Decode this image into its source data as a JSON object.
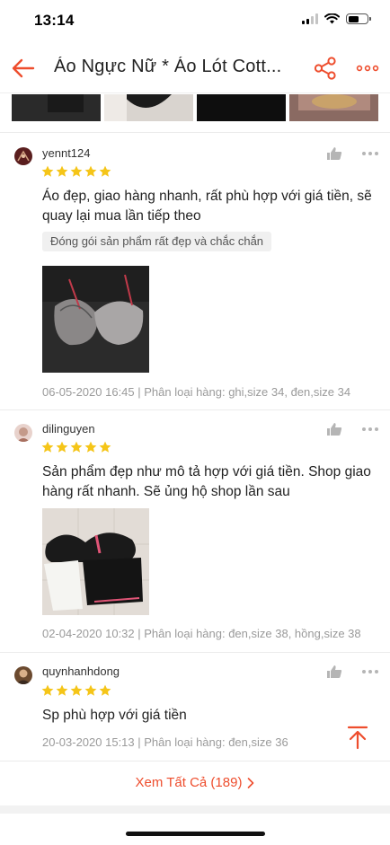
{
  "status_bar": {
    "time": "13:14",
    "battery_level": 0.55
  },
  "nav": {
    "title": "Áo Ngực Nữ * Áo Lót Cott..."
  },
  "icons": {
    "back": "arrow-left-icon",
    "share": "share-icon",
    "more": "more-dots-icon",
    "like": "thumbs-up-icon",
    "star": "star-icon",
    "scroll_top": "scroll-to-top-icon",
    "chevron": "chevron-right-icon"
  },
  "colors": {
    "accent": "#ee4d2d",
    "star": "#f5c518",
    "muted": "#9a9a9a",
    "tag_bg": "#f0f0f0"
  },
  "reviews": [
    {
      "username": "yennt124",
      "rating": 5,
      "text": "Áo đẹp, giao hàng nhanh, rất phù hợp với giá tiền, sẽ quay lại mua lần tiếp theo",
      "tag": "Đóng gói sản phẩm rất đẹp và chắc chắn",
      "meta": "06-05-2020 16:45 | Phân loại hàng: ghi,size 34, đen,size 34"
    },
    {
      "username": "dilinguyen",
      "rating": 5,
      "text": "Sản phẩm đẹp như mô tả hợp với giá tiền. Shop giao hàng rất nhanh. Sẽ ủng hộ shop lần sau",
      "meta": "02-04-2020 10:32 | Phân loại hàng: đen,size 38, hồng,size 38"
    },
    {
      "username": "quynhanhdong",
      "rating": 5,
      "text": "Sp phù hợp với giá tiền",
      "meta": "20-03-2020 15:13 | Phân loại hàng: đen,size 36"
    }
  ],
  "footer": {
    "see_all_label": "Xem Tất Cả (189)"
  }
}
